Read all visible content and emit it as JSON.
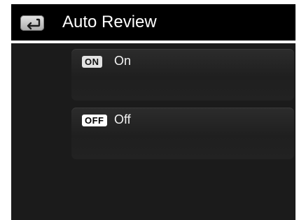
{
  "header": {
    "title": "Auto Review",
    "back_icon": "back-arrow-icon"
  },
  "menu": {
    "items": [
      {
        "badge": "ON",
        "label": "On"
      },
      {
        "badge": "OFF",
        "label": "Off"
      }
    ]
  },
  "colors": {
    "background": "#1b1b1b",
    "header": "#000000",
    "text": "#ffffff",
    "badge": "#e2e2e2"
  }
}
